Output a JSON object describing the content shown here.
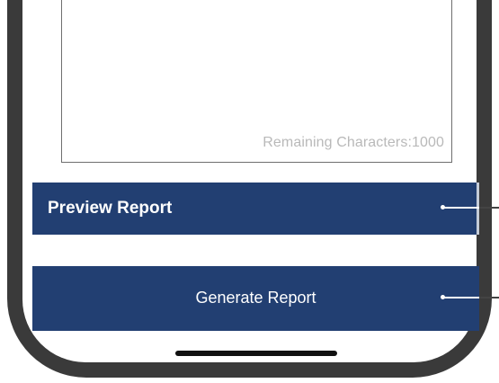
{
  "report_form": {
    "remaining_characters": "Remaining Characters:1000",
    "preview_label": "Preview Report",
    "generate_label": "Generate Report"
  },
  "colors": {
    "button_bg": "#223f72",
    "frame": "#3a3a3a",
    "placeholder_text": "#b9b9b9"
  },
  "icons": {
    "home_indicator": "home-indicator-bar"
  }
}
